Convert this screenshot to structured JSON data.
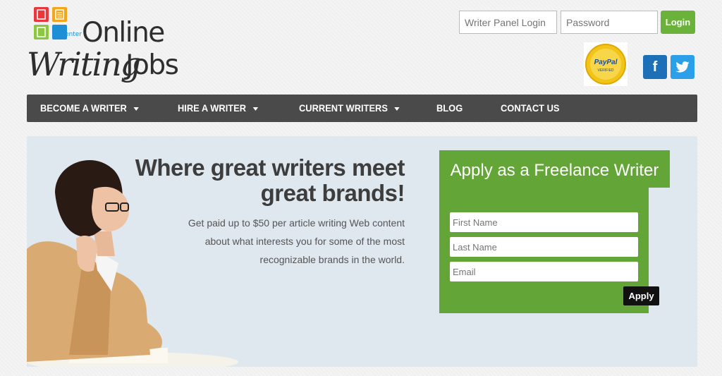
{
  "logo": {
    "enter": "enter",
    "word1": "Online",
    "word2": "Writing",
    "word3": "Jobs"
  },
  "login": {
    "username_placeholder": "Writer Panel Login",
    "password_placeholder": "Password",
    "button": "Login"
  },
  "badges": {
    "paypal_line1": "PayPal",
    "paypal_line2": "VERIFIED"
  },
  "social": {
    "facebook": "f",
    "twitter": "t"
  },
  "nav": [
    {
      "label": "BECOME A WRITER",
      "dropdown": true
    },
    {
      "label": "HIRE A WRITER",
      "dropdown": true
    },
    {
      "label": "CURRENT WRITERS",
      "dropdown": true
    },
    {
      "label": "BLOG",
      "dropdown": false
    },
    {
      "label": "CONTACT US",
      "dropdown": false
    }
  ],
  "hero": {
    "headline_line1": "Where great writers meet",
    "headline_line2": "great brands!",
    "subtext": "Get paid up to $50 per article writing Web content about what interests you for some of the most recognizable brands in the world."
  },
  "apply": {
    "title": "Apply as a Freelance Writer",
    "first_name": "First Name",
    "last_name": "Last Name",
    "email": "Email",
    "button": "Apply"
  },
  "colors": {
    "green": "#63a536",
    "nav": "#4a4a4a",
    "hero_bg": "#dfe7ef"
  }
}
